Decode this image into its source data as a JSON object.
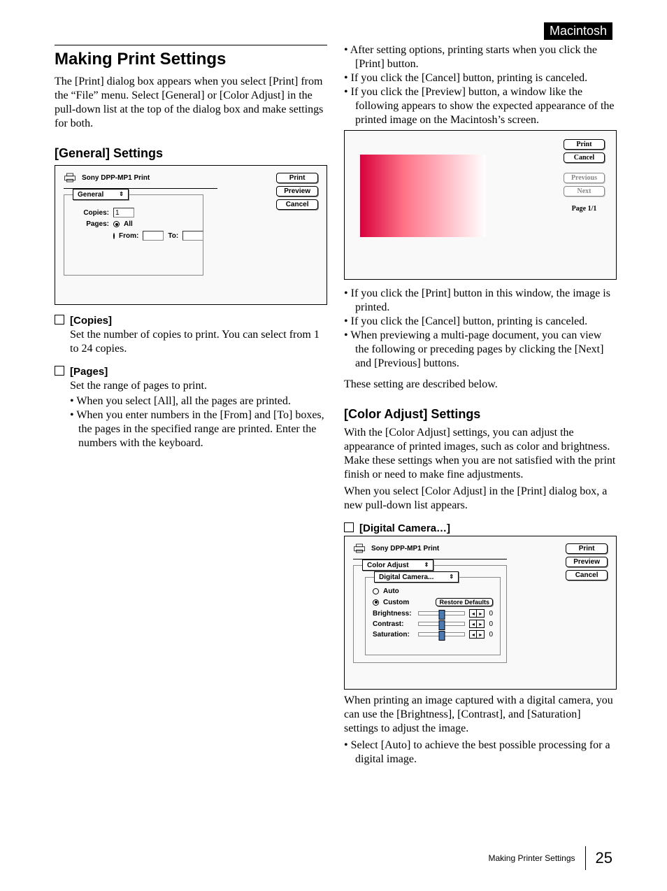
{
  "os_tag": "Macintosh",
  "title": "Making Print Settings",
  "intro": "The [Print] dialog box appears when you select [Print] from the “File” menu. Select [General] or [Color Adjust] in the pull-down list at the top of the dialog box and make settings for both.",
  "general_heading": "[General] Settings",
  "dlg1": {
    "device": "Sony DPP-MP1 Print",
    "btn_print": "Print",
    "btn_preview": "Preview",
    "btn_cancel": "Cancel",
    "pulldown": "General",
    "copies_lbl": "Copies:",
    "copies_val": "1",
    "pages_lbl": "Pages:",
    "opt_all": "All",
    "opt_from": "From:",
    "opt_to": "To:"
  },
  "copies_head": "[Copies]",
  "copies_desc": "Set the number of copies to print. You can select from 1 to 24 copies.",
  "pages_head": "[Pages]",
  "pages_desc": "Set the range of pages to print.",
  "pages_b1": "When you select [All], all the pages are printed.",
  "pages_b2": "When you enter numbers in the [From] and [To] boxes, the pages in the specified range are printed. Enter the numbers with the keyboard.",
  "col2_b1": "After setting options, printing starts when you click the [Print] button.",
  "col2_b2": "If you click the [Cancel] button, printing is canceled.",
  "col2_b3": "If you click the [Preview] button, a window like the following appears to show the expected appearance of the printed image on the Macintosh’s screen.",
  "preview": {
    "print": "Print",
    "cancel": "Cancel",
    "previous": "Previous",
    "next": "Next",
    "page": "Page 1/1"
  },
  "col2_b4": "If you click the [Print] button in this window, the image is printed.",
  "col2_b5": "If you click the [Cancel] button, printing is canceled.",
  "col2_b6": "When previewing a multi-page document, you can view the following or preceding pages by clicking the [Next] and [Previous] buttons.",
  "col2_p_after": "These setting are described below.",
  "coloradj_heading": "[Color Adjust] Settings",
  "coloradj_p1": "With the [Color Adjust] settings, you can adjust the appearance of printed images, such as color and brightness. Make these settings when you are not satisfied with the print finish or need to make fine adjustments.",
  "coloradj_p2": "When you select [Color Adjust] in the [Print] dialog box, a new pull-down list appears.",
  "digcam_head": "[Digital Camera…]",
  "dlg2": {
    "device": "Sony DPP-MP1 Print",
    "btn_print": "Print",
    "btn_preview": "Preview",
    "btn_cancel": "Cancel",
    "pulldown1": "Color Adjust",
    "pulldown2": "Digital Camera...",
    "auto": "Auto",
    "custom": "Custom",
    "restore": "Restore Defaults",
    "brightness": "Brightness:",
    "contrast": "Contrast:",
    "saturation": "Saturation:",
    "val0": "0"
  },
  "digcam_p": "When printing an image captured with a digital camera, you can use the [Brightness], [Contrast], and [Saturation] settings to adjust the image.",
  "digcam_b1": "Select [Auto] to achieve the best possible processing for a digital image.",
  "footer_section": "Making Printer Settings",
  "footer_page": "25"
}
